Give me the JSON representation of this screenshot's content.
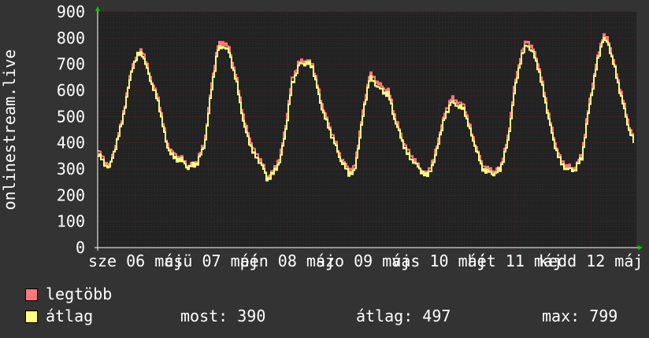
{
  "chart_data": {
    "type": "line",
    "ylabel": "onlinestream.live",
    "ylim": [
      0,
      900
    ],
    "yticks": [
      0,
      100,
      200,
      300,
      400,
      500,
      600,
      700,
      800,
      900
    ],
    "xticks": [
      "sze 06 máj",
      "csü 07 máj",
      "pén 08 máj",
      "szo 09 máj",
      "vas 10 máj",
      "hét 11 máj",
      "kedd 12 máj"
    ],
    "grid": true,
    "colors": {
      "background": "#333333",
      "plot": "#222222",
      "major_grid": "#4a1f1f",
      "minor_grid": "#2f2f2f",
      "axis": "#ffffff",
      "arrow": "#00cc00"
    },
    "series": [
      {
        "name": "legtöbb",
        "color": "#ff7878",
        "keypoints": [
          [
            0,
            375
          ],
          [
            0.15,
            330
          ],
          [
            0.3,
            310
          ],
          [
            0.6,
            470
          ],
          [
            0.9,
            700
          ],
          [
            1.05,
            740
          ],
          [
            1.15,
            760
          ],
          [
            1.35,
            660
          ],
          [
            1.6,
            560
          ],
          [
            1.8,
            400
          ],
          [
            2.0,
            355
          ],
          [
            2.2,
            340
          ],
          [
            2.35,
            310
          ],
          [
            2.6,
            330
          ],
          [
            2.8,
            400
          ],
          [
            3.0,
            640
          ],
          [
            3.15,
            770
          ],
          [
            3.3,
            785
          ],
          [
            3.45,
            760
          ],
          [
            3.65,
            640
          ],
          [
            3.85,
            480
          ],
          [
            4.1,
            370
          ],
          [
            4.3,
            330
          ],
          [
            4.45,
            270
          ],
          [
            4.6,
            290
          ],
          [
            4.8,
            350
          ],
          [
            4.95,
            480
          ],
          [
            5.1,
            640
          ],
          [
            5.3,
            710
          ],
          [
            5.5,
            715
          ],
          [
            5.65,
            700
          ],
          [
            5.85,
            570
          ],
          [
            6.0,
            500
          ],
          [
            6.2,
            420
          ],
          [
            6.4,
            340
          ],
          [
            6.6,
            300
          ],
          [
            6.75,
            300
          ],
          [
            6.9,
            450
          ],
          [
            7.0,
            540
          ],
          [
            7.15,
            665
          ],
          [
            7.3,
            640
          ],
          [
            7.5,
            610
          ],
          [
            7.65,
            600
          ],
          [
            7.8,
            510
          ],
          [
            8.0,
            420
          ],
          [
            8.15,
            370
          ],
          [
            8.3,
            340
          ],
          [
            8.5,
            300
          ],
          [
            8.65,
            280
          ],
          [
            8.85,
            340
          ],
          [
            9.0,
            440
          ],
          [
            9.15,
            520
          ],
          [
            9.3,
            570
          ],
          [
            9.5,
            555
          ],
          [
            9.65,
            540
          ],
          [
            9.85,
            430
          ],
          [
            10.0,
            370
          ],
          [
            10.1,
            320
          ],
          [
            10.25,
            300
          ],
          [
            10.45,
            290
          ],
          [
            10.6,
            310
          ],
          [
            10.8,
            420
          ],
          [
            10.95,
            600
          ],
          [
            11.15,
            745
          ],
          [
            11.3,
            790
          ],
          [
            11.45,
            760
          ],
          [
            11.6,
            700
          ],
          [
            11.8,
            560
          ],
          [
            12.0,
            420
          ],
          [
            12.2,
            330
          ],
          [
            12.35,
            310
          ],
          [
            12.55,
            300
          ],
          [
            12.75,
            360
          ],
          [
            12.95,
            560
          ],
          [
            13.15,
            720
          ],
          [
            13.3,
            810
          ],
          [
            13.45,
            790
          ],
          [
            13.6,
            700
          ],
          [
            13.8,
            580
          ],
          [
            14.0,
            460
          ],
          [
            14.15,
            400
          ]
        ]
      },
      {
        "name": "átlag",
        "color": "#ffff80",
        "keypoints": [
          [
            0,
            360
          ],
          [
            0.15,
            320
          ],
          [
            0.3,
            305
          ],
          [
            0.6,
            460
          ],
          [
            0.9,
            690
          ],
          [
            1.05,
            735
          ],
          [
            1.15,
            745
          ],
          [
            1.35,
            650
          ],
          [
            1.6,
            545
          ],
          [
            1.8,
            390
          ],
          [
            2.0,
            340
          ],
          [
            2.2,
            335
          ],
          [
            2.35,
            305
          ],
          [
            2.6,
            320
          ],
          [
            2.8,
            390
          ],
          [
            3.0,
            620
          ],
          [
            3.15,
            755
          ],
          [
            3.3,
            770
          ],
          [
            3.45,
            745
          ],
          [
            3.65,
            625
          ],
          [
            3.85,
            460
          ],
          [
            4.1,
            355
          ],
          [
            4.3,
            320
          ],
          [
            4.45,
            260
          ],
          [
            4.6,
            280
          ],
          [
            4.8,
            335
          ],
          [
            4.95,
            460
          ],
          [
            5.1,
            620
          ],
          [
            5.3,
            700
          ],
          [
            5.5,
            705
          ],
          [
            5.65,
            690
          ],
          [
            5.85,
            555
          ],
          [
            6.0,
            485
          ],
          [
            6.2,
            410
          ],
          [
            6.4,
            330
          ],
          [
            6.6,
            285
          ],
          [
            6.75,
            285
          ],
          [
            6.9,
            430
          ],
          [
            7.0,
            525
          ],
          [
            7.15,
            650
          ],
          [
            7.3,
            625
          ],
          [
            7.5,
            595
          ],
          [
            7.65,
            585
          ],
          [
            7.8,
            495
          ],
          [
            8.0,
            410
          ],
          [
            8.15,
            355
          ],
          [
            8.3,
            330
          ],
          [
            8.5,
            295
          ],
          [
            8.65,
            270
          ],
          [
            8.85,
            325
          ],
          [
            9.0,
            425
          ],
          [
            9.15,
            505
          ],
          [
            9.3,
            555
          ],
          [
            9.5,
            540
          ],
          [
            9.65,
            525
          ],
          [
            9.85,
            420
          ],
          [
            10.0,
            360
          ],
          [
            10.1,
            305
          ],
          [
            10.25,
            290
          ],
          [
            10.45,
            280
          ],
          [
            10.6,
            300
          ],
          [
            10.8,
            405
          ],
          [
            10.95,
            580
          ],
          [
            11.15,
            730
          ],
          [
            11.3,
            775
          ],
          [
            11.45,
            745
          ],
          [
            11.6,
            685
          ],
          [
            11.8,
            545
          ],
          [
            12.0,
            405
          ],
          [
            12.2,
            320
          ],
          [
            12.35,
            300
          ],
          [
            12.55,
            295
          ],
          [
            12.75,
            345
          ],
          [
            12.95,
            545
          ],
          [
            13.15,
            705
          ],
          [
            13.3,
            800
          ],
          [
            13.45,
            775
          ],
          [
            13.6,
            690
          ],
          [
            13.8,
            565
          ],
          [
            14.0,
            445
          ],
          [
            14.15,
            390
          ]
        ]
      }
    ]
  },
  "legend": {
    "max_label": "legtöbb",
    "avg_label": "átlag",
    "stats": {
      "current": "most: 390",
      "average": "átlag: 497",
      "maximum": "max: 799"
    }
  }
}
